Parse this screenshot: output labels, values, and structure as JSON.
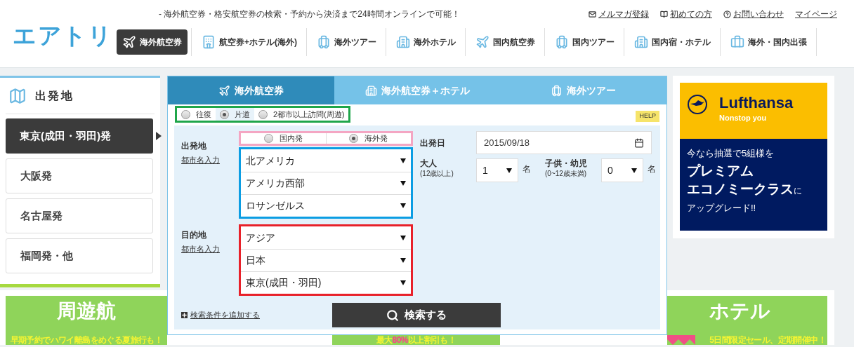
{
  "header": {
    "logo": "エアトリ",
    "tagline": "- 海外航空券・格安航空券の検索・予約から決済まで24時間オンラインで可能！",
    "top_links": [
      {
        "label": "メルマガ登録"
      },
      {
        "label": "初めての方"
      },
      {
        "label": "お問い合わせ"
      },
      {
        "label": "マイページ"
      }
    ],
    "nav": [
      {
        "label": "海外航空券",
        "selected": true
      },
      {
        "label": "航空券+ホテル(海外)",
        "selected": false
      },
      {
        "label": "海外ツアー",
        "selected": false
      },
      {
        "label": "海外ホテル",
        "selected": false
      },
      {
        "label": "国内航空券",
        "selected": false
      },
      {
        "label": "国内ツアー",
        "selected": false
      },
      {
        "label": "国内宿・ホテル",
        "selected": false
      },
      {
        "label": "海外・国内出張",
        "selected": false
      }
    ]
  },
  "departure": {
    "heading": "出発地",
    "items": [
      {
        "label": "東京(成田・羽田)発",
        "selected": true
      },
      {
        "label": "大阪発",
        "selected": false
      },
      {
        "label": "名古屋発",
        "selected": false
      },
      {
        "label": "福岡発・他",
        "selected": false
      }
    ]
  },
  "search": {
    "tabs": [
      {
        "label": "海外航空券",
        "selected": true
      },
      {
        "label": "海外航空券＋ホテル",
        "selected": false
      },
      {
        "label": "海外ツアー",
        "selected": false
      }
    ],
    "trip_types": [
      {
        "label": "往復",
        "selected": false
      },
      {
        "label": "片道",
        "selected": true
      },
      {
        "label": "2都市以上訪問(周遊)",
        "selected": false
      }
    ],
    "help": "HELP",
    "origin": {
      "label": "出発地",
      "link": "都市名入力",
      "scopes": [
        {
          "label": "国内発",
          "selected": false
        },
        {
          "label": "海外発",
          "selected": true
        }
      ],
      "selects": [
        "北アメリカ",
        "アメリカ西部",
        "ロサンゼルス"
      ]
    },
    "destination": {
      "label": "目的地",
      "link": "都市名入力",
      "selects": [
        "アジア",
        "日本",
        "東京(成田・羽田)"
      ]
    },
    "date": {
      "label": "出発日",
      "value": "2015/09/18"
    },
    "adults": {
      "label": "大人",
      "note": "(12歳以上)",
      "value": "1",
      "unit": "名"
    },
    "children": {
      "label": "子供・幼児",
      "note": "(0~12歳未満)",
      "value": "0",
      "unit": "名"
    },
    "add_conditions": "検索条件を追加する",
    "submit": "検索する"
  },
  "ad": {
    "brand": "Lufthansa",
    "slogan": "Nonstop you",
    "lines": [
      {
        "text": "今なら抽選で5組様を",
        "kind": "small"
      },
      {
        "text": "プレミアム",
        "kind": "large"
      },
      {
        "text": "エコノミークラス",
        "kind": "large",
        "suffix": "に"
      },
      {
        "text": "アップグレード!!",
        "kind": "small"
      }
    ]
  },
  "banners": [
    {
      "title": "周遊航",
      "subtitle": "早期予約でハワイ離島をめぐる夏旅行も！"
    },
    {
      "subtitle": "最大**80%**以上割引も！"
    },
    {
      "title": "ホテル",
      "subtitle": "5日間限定セール、定期開催中！"
    }
  ]
}
